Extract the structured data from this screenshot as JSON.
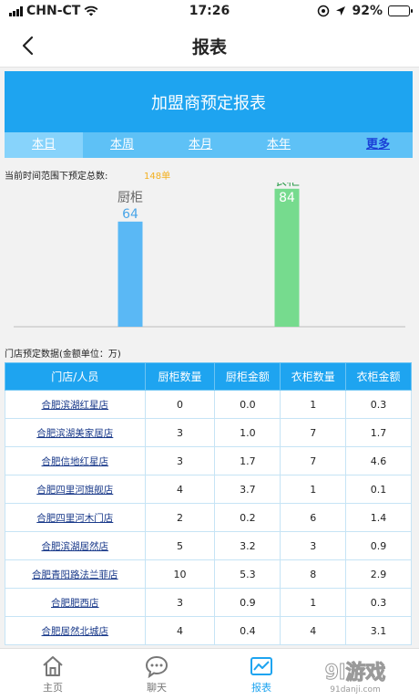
{
  "status_bar": {
    "carrier": "CHN-CT",
    "time": "17:26",
    "battery": "92%",
    "battery_level": 0.92
  },
  "nav": {
    "title": "报表"
  },
  "banner": {
    "title": "加盟商预定报表"
  },
  "period_tabs": [
    {
      "label": "本日",
      "active": true
    },
    {
      "label": "本周",
      "active": false
    },
    {
      "label": "本月",
      "active": false
    },
    {
      "label": "本年",
      "active": false
    }
  ],
  "more_label": "更多",
  "summary": {
    "label": "当前时间范围下预定总数:",
    "count": "148单"
  },
  "chart_data": {
    "type": "bar",
    "categories": [
      "厨柜",
      "衣柜"
    ],
    "values": [
      64,
      84
    ],
    "colors": [
      "#5ab8f5",
      "#76db8e"
    ],
    "ylim": [
      0,
      100
    ],
    "grid": false,
    "legend": "none"
  },
  "table": {
    "title": "门店预定数据(金额单位：万)",
    "headers": [
      "门店/人员",
      "厨柜数量",
      "厨柜金额",
      "衣柜数量",
      "衣柜金额"
    ],
    "rows": [
      [
        "合肥滨湖红星店",
        "0",
        "0.0",
        "1",
        "0.3"
      ],
      [
        "合肥滨湖美家居店",
        "3",
        "1.0",
        "7",
        "1.7"
      ],
      [
        "合肥信地红星店",
        "3",
        "1.7",
        "7",
        "4.6"
      ],
      [
        "合肥四里河旗舰店",
        "4",
        "3.7",
        "1",
        "0.1"
      ],
      [
        "合肥四里河木门店",
        "2",
        "0.2",
        "6",
        "1.4"
      ],
      [
        "合肥滨湖居然店",
        "5",
        "3.2",
        "3",
        "0.9"
      ],
      [
        "合肥青阳路法兰菲店",
        "10",
        "5.3",
        "8",
        "2.9"
      ],
      [
        "合肥肥西店",
        "3",
        "0.9",
        "1",
        "0.3"
      ],
      [
        "合肥居然北城店",
        "4",
        "0.4",
        "4",
        "3.1"
      ]
    ]
  },
  "bottom_nav": [
    {
      "label": "主页",
      "icon": "home-icon",
      "active": false
    },
    {
      "label": "聊天",
      "icon": "chat-icon",
      "active": false
    },
    {
      "label": "报表",
      "icon": "report-icon",
      "active": true
    }
  ],
  "watermark": {
    "text": "9l游戏",
    "subtext": "91danji.com"
  },
  "colors": {
    "accent": "#1ea4f0",
    "tab_bg": "#5ec1f6",
    "tab_active": "#87d3fb",
    "bar_cabinet": "#5ab8f5",
    "bar_wardrobe": "#76db8e",
    "summary_count": "#f3b020"
  }
}
